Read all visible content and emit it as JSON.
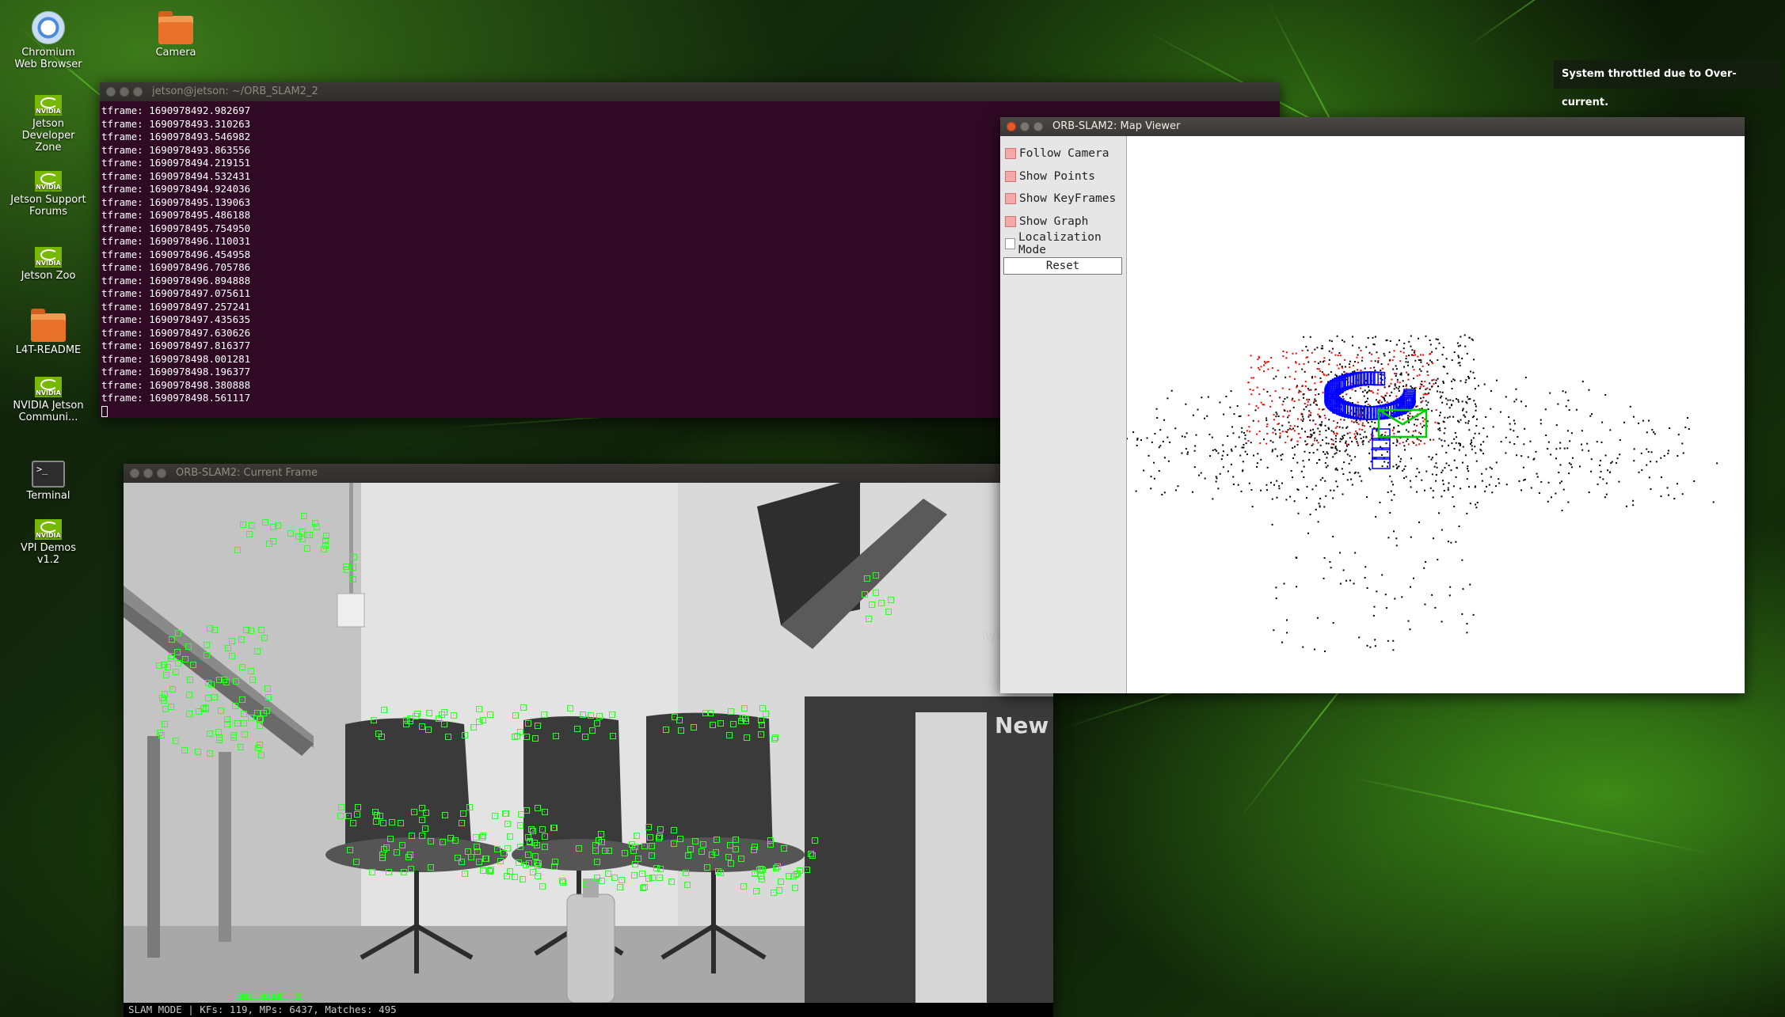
{
  "desktop": {
    "icons": [
      {
        "label": "Chromium Web Browser",
        "icon": "chromium-icon"
      },
      {
        "label": "Camera",
        "icon": "folder-icon"
      },
      {
        "label": "Jetson Developer Zone",
        "icon": "nvidia-icon"
      },
      {
        "label": "Jetson Support Forums",
        "icon": "nvidia-icon"
      },
      {
        "label": "Jetson Zoo",
        "icon": "nvidia-icon"
      },
      {
        "label": "L4T-README",
        "icon": "folder-icon"
      },
      {
        "label": "NVIDIA Jetson Communi...",
        "icon": "nvidia-icon"
      },
      {
        "label": "Terminal",
        "icon": "terminal-icon"
      },
      {
        "label": "VPI Demos v1.2",
        "icon": "nvidia-icon"
      }
    ],
    "nvidia_badge": "NVIDIA",
    "terminal_glyph": ">_"
  },
  "notification": {
    "text": "System throttled due to Over-current."
  },
  "terminal": {
    "title": "jetson@jetson: ~/ORB_SLAM2_2",
    "lines": [
      "tframe: 1690978492.982697",
      "tframe: 1690978493.310263",
      "tframe: 1690978493.546982",
      "tframe: 1690978493.863556",
      "tframe: 1690978494.219151",
      "tframe: 1690978494.532431",
      "tframe: 1690978494.924036",
      "tframe: 1690978495.139063",
      "tframe: 1690978495.486188",
      "tframe: 1690978495.754950",
      "tframe: 1690978496.110031",
      "tframe: 1690978496.454958",
      "tframe: 1690978496.705786",
      "tframe: 1690978496.894888",
      "tframe: 1690978497.075611",
      "tframe: 1690978497.257241",
      "tframe: 1690978497.435635",
      "tframe: 1690978497.630626",
      "tframe: 1690978497.816377",
      "tframe: 1690978498.001281",
      "tframe: 1690978498.196377",
      "tframe: 1690978498.380888",
      "tframe: 1690978498.561117"
    ]
  },
  "current_frame": {
    "title": "ORB-SLAM2: Current Frame",
    "status": "SLAM MODE |  KFs: 119, MPs: 6437, Matches: 495",
    "monitor_brand": "iiyama",
    "sign_text": "New Uni"
  },
  "map_viewer": {
    "title": "ORB-SLAM2: Map Viewer",
    "options": [
      {
        "label": "Follow Camera",
        "checked": true
      },
      {
        "label": "Show Points",
        "checked": true
      },
      {
        "label": "Show KeyFrames",
        "checked": true
      },
      {
        "label": "Show Graph",
        "checked": true
      },
      {
        "label": "Localization Mode",
        "checked": false
      }
    ],
    "reset_label": "Reset"
  },
  "colors": {
    "keypoint": "#31ff2a",
    "map_points": "#000000",
    "local_points": "#ff0000",
    "keyframes": "#0000ff",
    "current_camera": "#00cc00"
  }
}
